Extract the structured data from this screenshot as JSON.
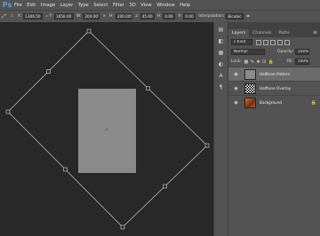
{
  "app": {
    "logo": "Ps"
  },
  "menu": [
    "File",
    "Edit",
    "Image",
    "Layer",
    "Type",
    "Select",
    "Filter",
    "3D",
    "View",
    "Window",
    "Help"
  ],
  "options": {
    "x_label": "X:",
    "x_value": "1306.50 px",
    "y_label": "Y:",
    "y_value": "1650.00 px",
    "w_label": "W:",
    "w_value": "200.00%",
    "h_label": "H:",
    "h_value": "200.00%",
    "angle_value": "45.00",
    "h2_label": "H:",
    "h2_value": "0.00",
    "v_label": "V:",
    "v_value": "0.00",
    "interpolation_label": "Interpolation:",
    "interpolation_value": "Bicubic"
  },
  "panel": {
    "tabs": [
      "Layers",
      "Channels",
      "Paths"
    ],
    "filter_kind": "Kind",
    "blend_mode": "Normal",
    "opacity_label": "Opacity:",
    "opacity_value": "100%",
    "lock_label": "Lock:",
    "fill_label": "Fill:",
    "fill_value": "100%",
    "layers": [
      {
        "name": "Halftone Pattern",
        "selected": true
      },
      {
        "name": "Halftone Overlay",
        "selected": false
      },
      {
        "name": "Background",
        "selected": false
      }
    ]
  },
  "canvas": {
    "bg": "#282828",
    "document_fill": "#8a8a8a",
    "transform_stroke": "#c8c8c8"
  }
}
